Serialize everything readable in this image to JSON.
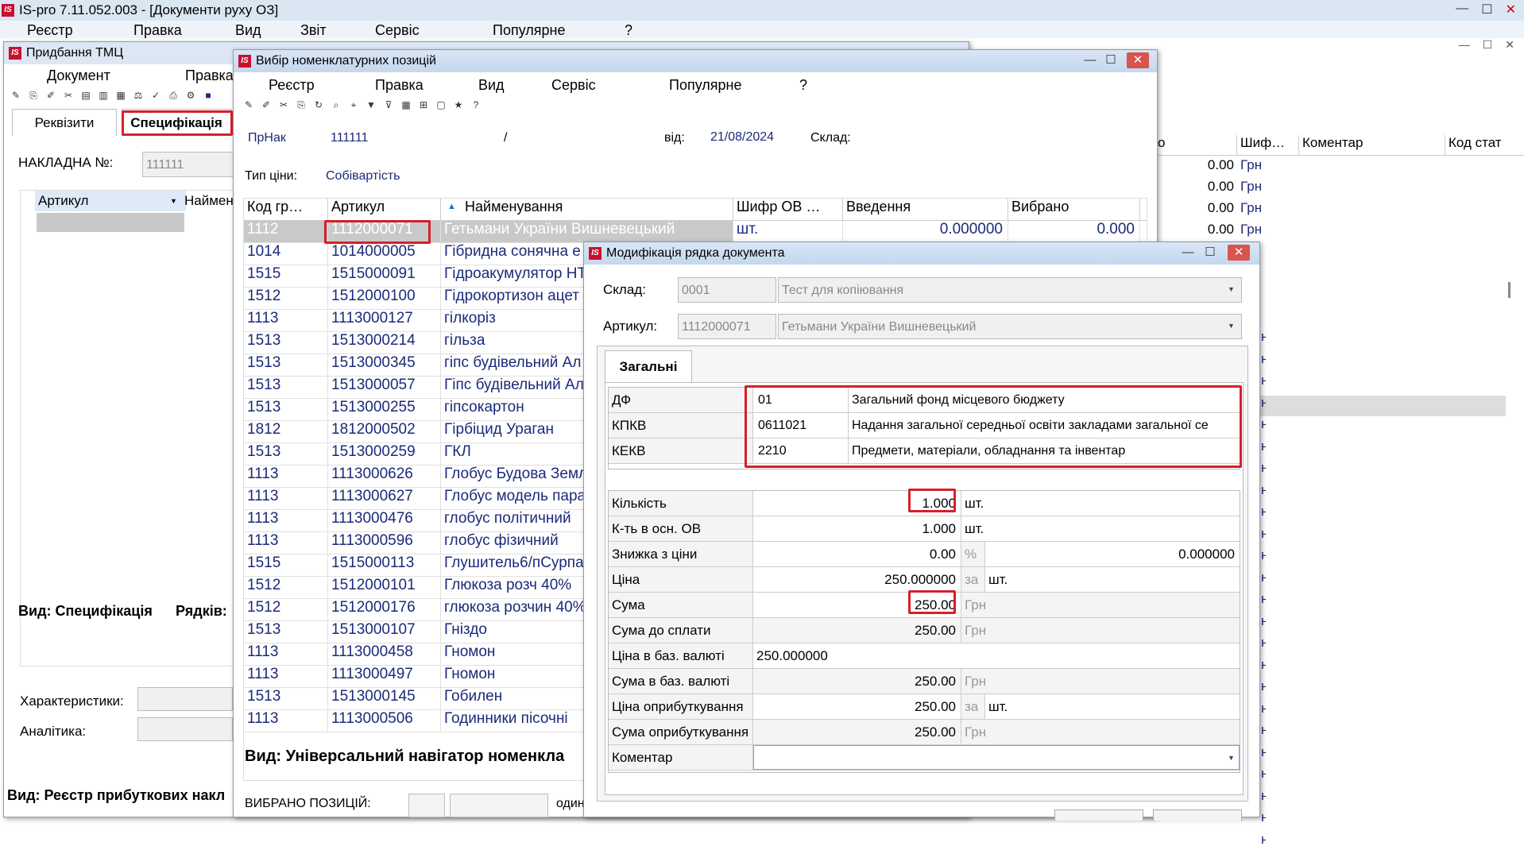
{
  "app": {
    "title": "IS-pro 7.11.052.003 - [Документи руху ОЗ]",
    "menu": [
      "Реєстр",
      "Правка",
      "Вид",
      "Звіт",
      "Сервіс",
      "Популярне",
      "?"
    ]
  },
  "purchase": {
    "title": "Придбання ТМЦ",
    "menu": [
      "Документ",
      "Правка"
    ],
    "tabs": [
      "Реквізити",
      "Специфікація"
    ],
    "invoice_label": "НАКЛАДНА №:",
    "invoice_value": "111111",
    "col_article": "Артикул",
    "col_name": "Наймен",
    "footer_view": "Вид: Специфікація",
    "footer_rows": "Рядків:",
    "characteristics": "Характеристики:",
    "analytics": "Аналітика:",
    "bottom_view": "Вид: Реєстр прибуткових накл"
  },
  "right_grid": {
    "headers": [
      "о",
      "Шиф…",
      "Коментар",
      "Код стат"
    ],
    "rows": [
      [
        "0.00",
        "Грн"
      ],
      [
        "0.00",
        "Грн"
      ],
      [
        "0.00",
        "Грн"
      ],
      [
        "0.00",
        "Грн"
      ]
    ],
    "tail_label": "рн"
  },
  "selector": {
    "title": "Вибір номенклатурних позицій",
    "menu": [
      "Реєстр",
      "Правка",
      "Вид",
      "Сервіс",
      "Популярне",
      "?"
    ],
    "doc_type": "ПрНак",
    "doc_num": "111111",
    "slash": "/",
    "from_label": "від:",
    "date": "21/08/2024",
    "store_label": "Склад:",
    "price_type_label": "Тип ціни:",
    "price_type": "Собівартість",
    "headers": [
      "Код гр…",
      "Артикул",
      "Найменування",
      "Шифр ОВ …",
      "Введення",
      "Вибрано"
    ],
    "rows": [
      {
        "code": "1112",
        "art": "1112000071",
        "name": "Гетьмани України Вишневецький",
        "unit": "шт.",
        "entry": "0.000000",
        "chosen": "0.000"
      },
      {
        "code": "1014",
        "art": "1014000005",
        "name": "Гібридна сонячна е"
      },
      {
        "code": "1515",
        "art": "1515000091",
        "name": "Гідроакумулятор HT"
      },
      {
        "code": "1512",
        "art": "1512000100",
        "name": "Гідрокортизон ацет"
      },
      {
        "code": "1113",
        "art": "1113000127",
        "name": "гілкоріз"
      },
      {
        "code": "1513",
        "art": "1513000214",
        "name": "гільза"
      },
      {
        "code": "1513",
        "art": "1513000345",
        "name": "гіпс будівельний Ал"
      },
      {
        "code": "1513",
        "art": "1513000057",
        "name": "Гіпс будівельний Ал"
      },
      {
        "code": "1513",
        "art": "1513000255",
        "name": "гіпсокартон"
      },
      {
        "code": "1812",
        "art": "1812000502",
        "name": "Гірбіцид Ураган"
      },
      {
        "code": "1513",
        "art": "1513000259",
        "name": "ГКЛ"
      },
      {
        "code": "1113",
        "art": "1113000626",
        "name": "Глобус Будова Земл"
      },
      {
        "code": "1113",
        "art": "1113000627",
        "name": "Глобус модель пара"
      },
      {
        "code": "1113",
        "art": "1113000476",
        "name": "глобус політичний"
      },
      {
        "code": "1113",
        "art": "1113000596",
        "name": "глобус фізичний"
      },
      {
        "code": "1515",
        "art": "1515000113",
        "name": "Глушитель6/пСурпа"
      },
      {
        "code": "1512",
        "art": "1512000101",
        "name": "Глюкоза розч 40%"
      },
      {
        "code": "1512",
        "art": "1512000176",
        "name": "глюкоза розчин 40%"
      },
      {
        "code": "1513",
        "art": "1513000107",
        "name": "Гніздо"
      },
      {
        "code": "1113",
        "art": "1113000458",
        "name": "Гномон"
      },
      {
        "code": "1113",
        "art": "1113000497",
        "name": "Гномон"
      },
      {
        "code": "1513",
        "art": "1513000145",
        "name": "Гобилен"
      },
      {
        "code": "1113",
        "art": "1113000506",
        "name": "Годинники пісочні"
      }
    ],
    "footer_view": "Вид: Універсальний навігатор номенкла",
    "selected_label": "ВИБРАНО ПОЗИЦІЙ:",
    "units_label": "один"
  },
  "modify": {
    "title": "Модифікація рядка документа",
    "store_label": "Склад:",
    "store_code": "0001",
    "store_name": "Тест для копіювання",
    "article_label": "Артикул:",
    "article_code": "1112000071",
    "article_name": "Гетьмани України Вишневецький",
    "tab": "Загальні",
    "codes": [
      {
        "k": "ДФ",
        "c": "01",
        "n": "Загальний фонд місцевого бюджету"
      },
      {
        "k": "КПКВ",
        "c": "0611021",
        "n": "Надання загальної середньої освіти закладами загальної се"
      },
      {
        "k": "КЕКВ",
        "c": "2210",
        "n": "Предмети, матеріали, обладнання та інвентар"
      }
    ],
    "fields": [
      {
        "k": "Кількість",
        "v": "1.000",
        "u": "шт."
      },
      {
        "k": "К-ть в осн. ОВ",
        "v": "1.000",
        "u": "шт."
      },
      {
        "k": "Знижка з ціни",
        "v": "0.00",
        "u": "%",
        "x": "0.000000"
      },
      {
        "k": "Ціна",
        "v": "250.000000",
        "u": "за",
        "x": "шт."
      },
      {
        "k": "Сума",
        "v": "250.00",
        "u": "Грн"
      },
      {
        "k": "Сума до сплати",
        "v": "250.00",
        "u": "Грн"
      },
      {
        "k": "Ціна в баз. валюті",
        "v": "250.000000",
        "u": ""
      },
      {
        "k": "Сума в баз. валюті",
        "v": "250.00",
        "u": "Грн"
      },
      {
        "k": "Ціна оприбуткування",
        "v": "250.00",
        "u": "за",
        "x": "шт."
      },
      {
        "k": "Сума оприбуткування",
        "v": "250.00",
        "u": "Грн"
      },
      {
        "k": "Коментар",
        "v": "",
        "u": ""
      }
    ]
  }
}
